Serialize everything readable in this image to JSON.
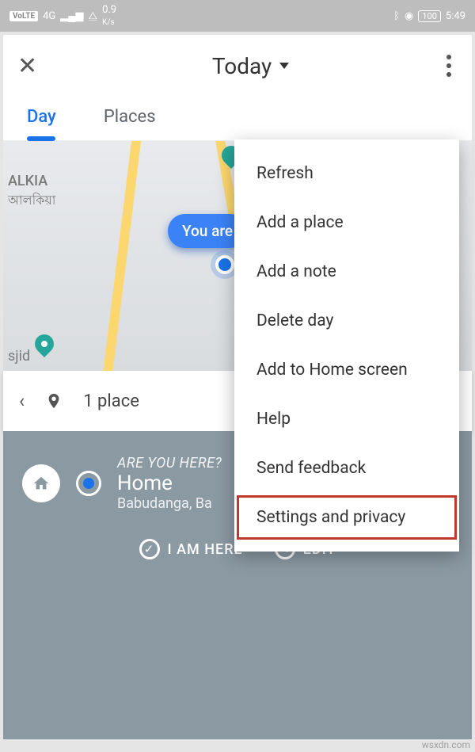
{
  "statusbar": {
    "volte": "VoLTE",
    "net": "4G",
    "speed": "0.9",
    "speed_unit": "K/s",
    "battery": "100",
    "time": "5:49"
  },
  "topbar": {
    "title": "Today"
  },
  "tabs": {
    "day": "Day",
    "places": "Places"
  },
  "map": {
    "label_alkia": "ALKIA",
    "label_alkia_native": "আলকিয়া",
    "label_sjid": "sjid",
    "you_are": "You are"
  },
  "places_row": {
    "text": "1 place"
  },
  "bottom": {
    "question": "ARE YOU HERE?",
    "name": "Home",
    "address": "Babudanga, Ba",
    "iamhere": "I AM HERE",
    "edit": "EDIT"
  },
  "menu": {
    "items": [
      "Refresh",
      "Add a place",
      "Add a note",
      "Delete day",
      "Add to Home screen",
      "Help",
      "Send feedback",
      "Settings and privacy"
    ]
  },
  "watermark": "wsxdn.com"
}
